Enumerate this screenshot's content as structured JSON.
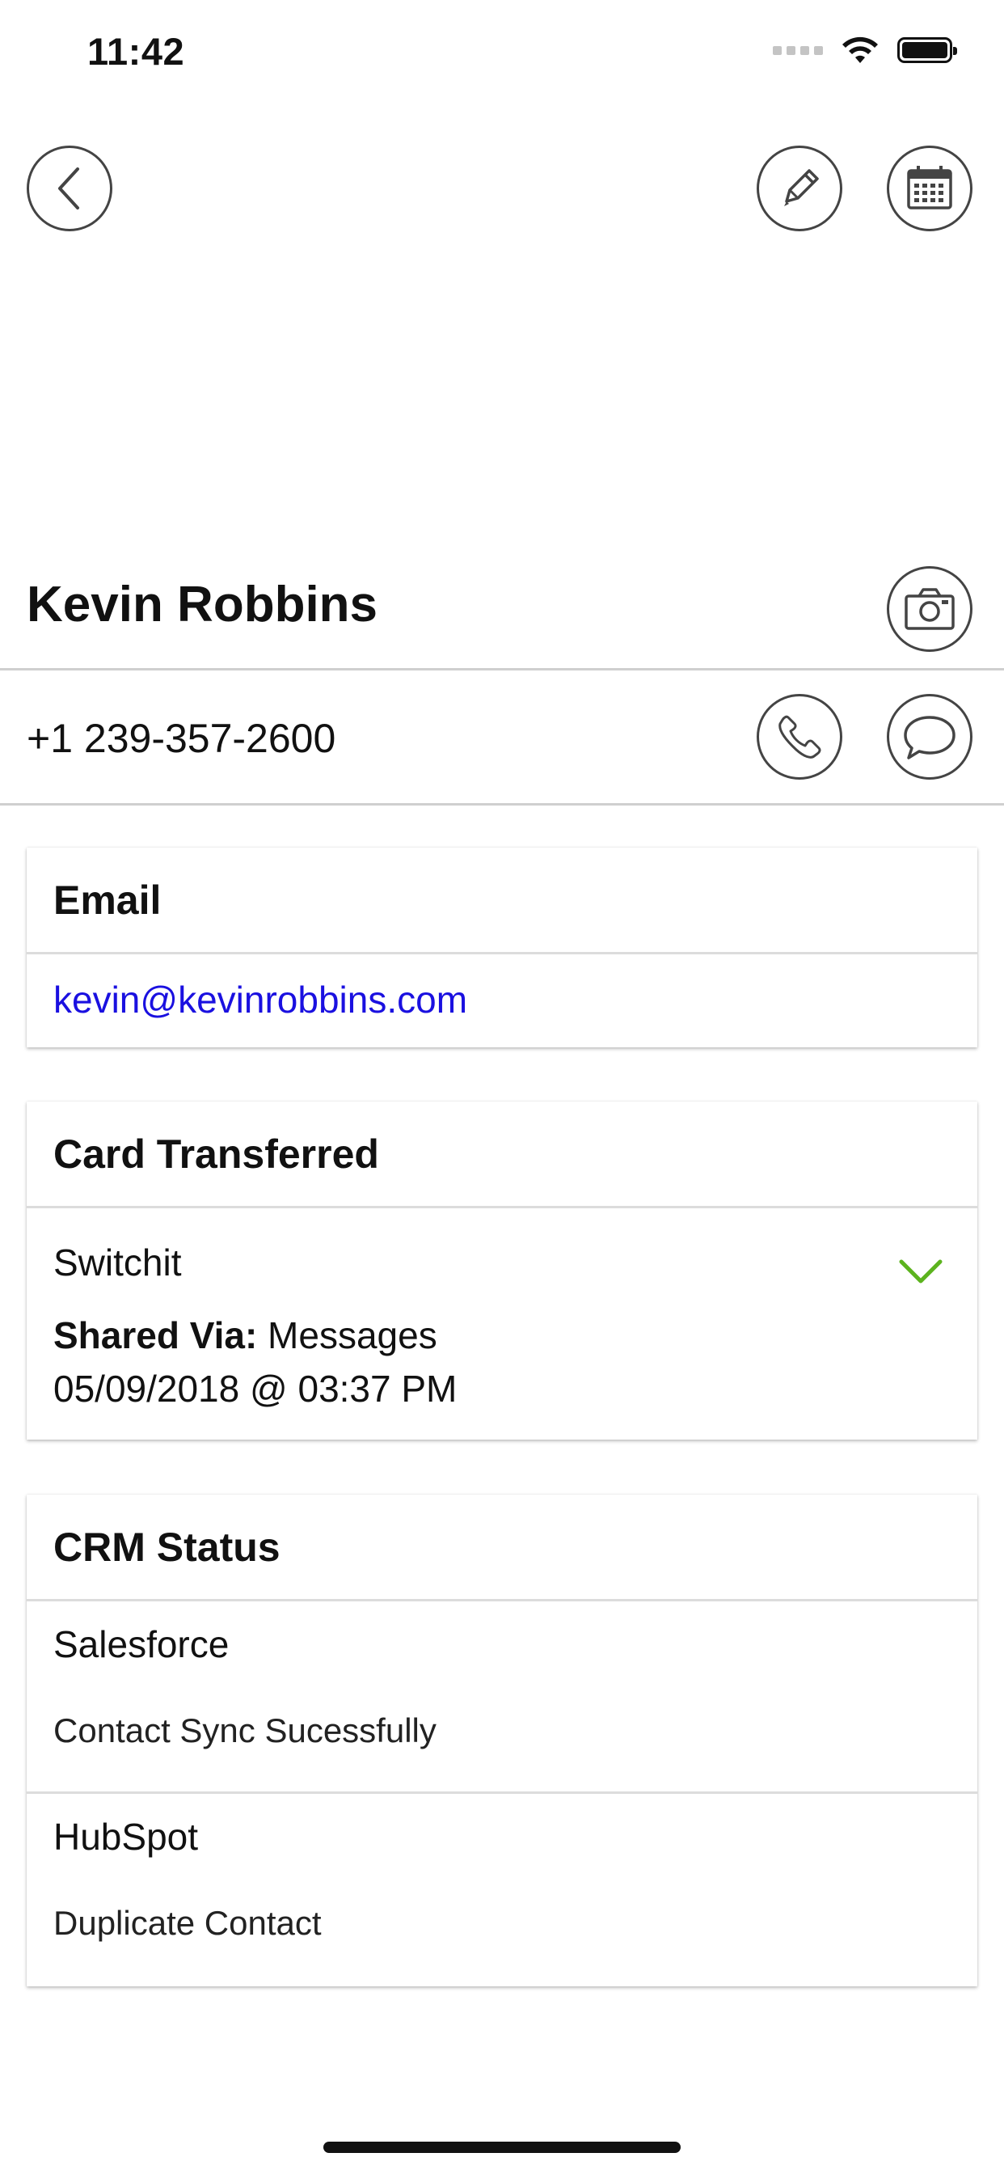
{
  "status_bar": {
    "time": "11:42"
  },
  "contact": {
    "name": "Kevin Robbins",
    "phone": "+1 239-357-2600"
  },
  "email_card": {
    "title": "Email",
    "email": "kevin@kevinrobbins.com"
  },
  "transfer_card": {
    "title": "Card Transferred",
    "app": "Switchit",
    "shared_via_label": "Shared Via:",
    "shared_via_value": "Messages",
    "datetime": "05/09/2018 @ 03:37 PM"
  },
  "crm_card": {
    "title": "CRM Status",
    "items": [
      {
        "name": "Salesforce",
        "status": "Contact Sync Sucessfully"
      },
      {
        "name": "HubSpot",
        "status": "Duplicate Contact"
      }
    ]
  },
  "colors": {
    "link": "#1a10e0",
    "check": "#5cb31e",
    "icon_stroke": "#444444"
  },
  "icons": [
    "back-icon",
    "edit-icon",
    "calendar-icon",
    "camera-icon",
    "phone-icon",
    "message-icon",
    "checkmark-icon",
    "wifi-icon",
    "battery-icon",
    "signal-icon"
  ]
}
